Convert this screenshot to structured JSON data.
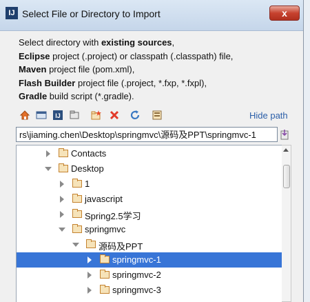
{
  "window": {
    "title": "Select File or Directory to Import",
    "close_label": "x"
  },
  "description": {
    "line1_pre": "Select directory with ",
    "line1_bold": "existing sources",
    "line1_post": ",",
    "line2_bold": "Eclipse",
    "line2_post": " project (.project) or classpath (.classpath) file,",
    "line3_bold": "Maven",
    "line3_post": " project file (pom.xml),",
    "line4_bold": "Flash Builder",
    "line4_post": " project file (.project, *.fxp, *.fxpl),",
    "line5_bold": "Gradle",
    "line5_post": " build script (*.gradle)."
  },
  "toolbar": {
    "icons": [
      "home-icon",
      "desktop-icon",
      "project-icon",
      "module-icon",
      "new-folder-icon",
      "delete-icon",
      "refresh-icon",
      "show-hidden-icon"
    ],
    "hide_path_label": "Hide path"
  },
  "path": {
    "value": "rs\\jiaming.chen\\Desktop\\springmvc\\源码及PPT\\springmvc-1"
  },
  "tree": [
    {
      "label": "Contacts",
      "state": "collapsed",
      "selected": false
    },
    {
      "label": "Desktop",
      "state": "expanded",
      "selected": false
    },
    {
      "label": "1",
      "state": "collapsed",
      "selected": false
    },
    {
      "label": "javascript",
      "state": "collapsed",
      "selected": false
    },
    {
      "label": "Spring2.5学习",
      "state": "collapsed",
      "selected": false
    },
    {
      "label": "springmvc",
      "state": "expanded",
      "selected": false
    },
    {
      "label": "源码及PPT",
      "state": "expanded",
      "selected": false
    },
    {
      "label": "springmvc-1",
      "state": "collapsed",
      "selected": true
    },
    {
      "label": "springmvc-2",
      "state": "collapsed",
      "selected": false
    },
    {
      "label": "springmvc-3",
      "state": "collapsed",
      "selected": false
    }
  ],
  "colors": {
    "selection": "#3875d7",
    "link": "#2a5ea8",
    "folder": "#c4822e"
  }
}
